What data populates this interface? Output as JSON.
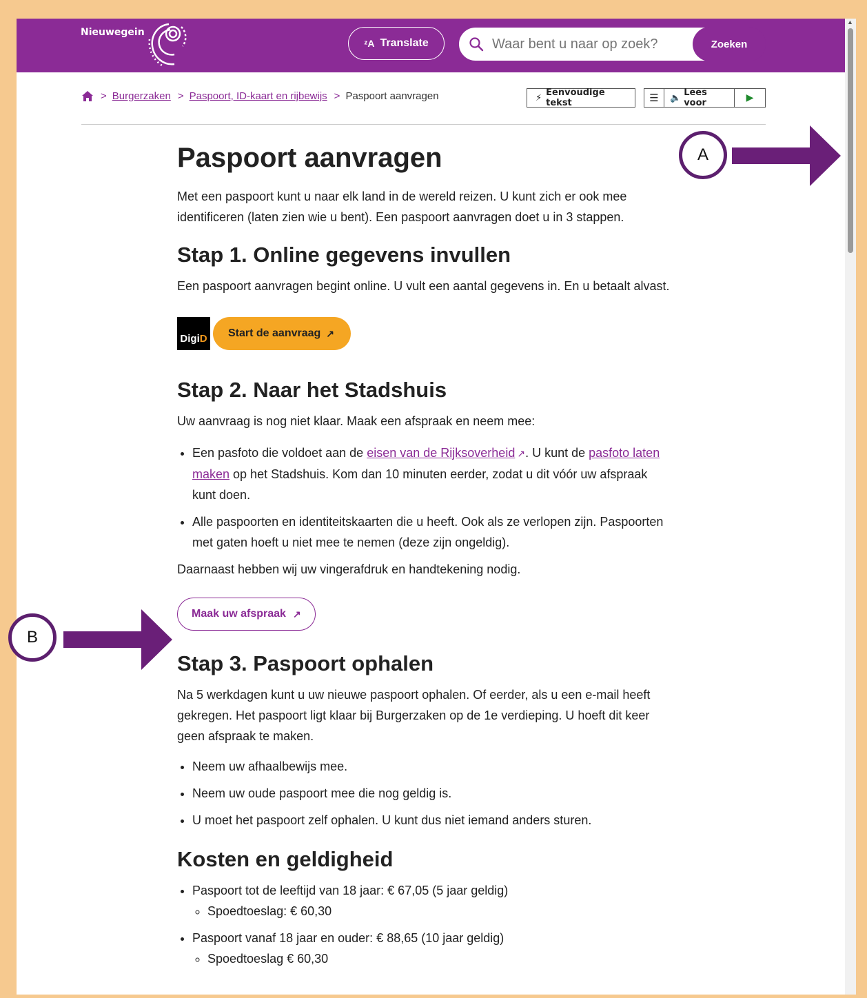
{
  "header": {
    "logo_text": "Nieuwegein",
    "translate_label": "Translate",
    "search_placeholder": "Waar bent u naar op zoek?",
    "search_button": "Zoeken"
  },
  "breadcrumb": {
    "items": [
      "Burgerzaken",
      "Paspoort, ID-kaart en rijbewijs"
    ],
    "current": "Paspoort aanvragen"
  },
  "tools": {
    "simple_text": "Eenvoudige tekst",
    "read_aloud": "Lees voor"
  },
  "content": {
    "title": "Paspoort aanvragen",
    "intro": "Met een paspoort kunt u naar elk land in de wereld reizen. U kunt zich er ook mee identificeren (laten zien wie u bent). Een paspoort aanvragen doet u in 3 stappen.",
    "step1_title": "Stap 1. Online gegevens invullen",
    "step1_text": "Een paspoort aanvragen begint online. U vult een aantal gegevens in. En u betaalt alvast.",
    "digid_a": "Digi",
    "digid_b": "D",
    "start_button": "Start de aanvraag",
    "step2_title": "Stap 2. Naar het Stadshuis",
    "step2_text": "Uw aanvraag is nog niet klaar. Maak een afspraak en neem mee:",
    "step2_item1_a": "Een pasfoto die voldoet aan de ",
    "step2_item1_link1": "eisen van de Rijksoverheid",
    "step2_item1_b": ". U kunt de ",
    "step2_item1_link2": "pasfoto laten maken",
    "step2_item1_c": " op het Stadshuis. Kom dan 10 minuten eerder, zodat u dit vóór uw afspraak kunt doen.",
    "step2_item2": "Alle paspoorten en identiteitskaarten die u heeft. Ook als ze verlopen zijn. Paspoorten met gaten hoeft u niet mee te nemen (deze zijn ongeldig).",
    "step2_extra": "Daarnaast hebben wij uw vingerafdruk en handtekening nodig.",
    "appointment_button": "Maak uw afspraak",
    "step3_title": "Stap 3. Paspoort ophalen",
    "step3_text": "Na 5 werkdagen kunt u uw nieuwe paspoort ophalen. Of eerder, als u een e-mail heeft gekregen. Het paspoort ligt klaar bij Burgerzaken op de 1e verdieping. U hoeft dit keer geen afspraak te maken.",
    "step3_items": [
      "Neem uw afhaalbewijs mee.",
      "Neem uw oude paspoort mee die nog geldig is.",
      "U moet het paspoort zelf ophalen. U kunt dus niet iemand anders sturen."
    ],
    "costs_title": "Kosten en geldigheid",
    "cost1": "Paspoort tot de leeftijd van 18 jaar: € 67,05 (5 jaar geldig)",
    "cost1_sub": "Spoedtoeslag: € 60,30",
    "cost2": "Paspoort vanaf 18 jaar en ouder: € 88,65 (10 jaar geldig)",
    "cost2_sub": "Spoedtoeslag € 60,30"
  },
  "annotations": {
    "marker_a": "A",
    "marker_b": "B"
  },
  "colors": {
    "brand": "#8b2b96",
    "accent": "#f5a623",
    "border": "#f6c98f",
    "arrow": "#6a1f78"
  }
}
